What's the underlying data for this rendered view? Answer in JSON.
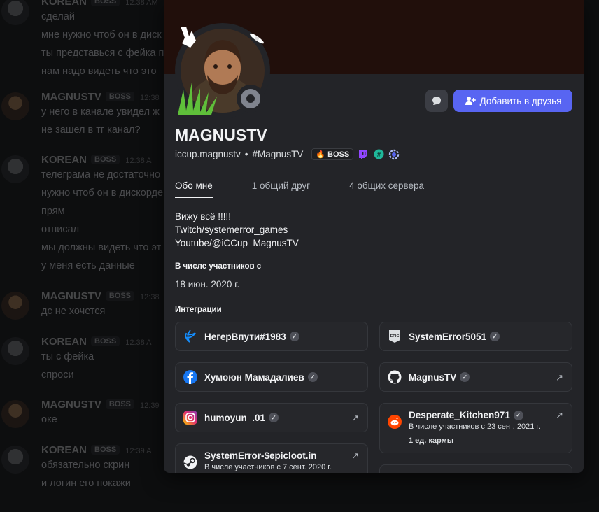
{
  "chat": {
    "messages": [
      {
        "author": "KOREAN",
        "badge": "BOSS",
        "time": "12:38 AM",
        "lines": [
          "сделай",
          "мне нужно чтоб он в диск",
          "ты представься с фейка п",
          "нам надо видеть что это"
        ]
      },
      {
        "author": "MAGNUSTV",
        "badge": "BOSS",
        "time": "12:38",
        "lines": [
          "у него в канале увидел ж",
          "не зашел в тг канал?"
        ]
      },
      {
        "author": "KOREAN",
        "badge": "BOSS",
        "time": "12:38 A",
        "lines": [
          "телеграма не достаточно",
          "нужно чтоб он в дискорде",
          "прям",
          "отписал",
          "мы должны видеть что эт",
          "у меня есть данные"
        ]
      },
      {
        "author": "MAGNUSTV",
        "badge": "BOSS",
        "time": "12:38",
        "lines": [
          "дс не хочется"
        ]
      },
      {
        "author": "KOREAN",
        "badge": "BOSS",
        "time": "12:38 A",
        "lines": [
          "ты с фейка",
          "спроси"
        ]
      },
      {
        "author": "MAGNUSTV",
        "badge": "BOSS",
        "time": "12:39",
        "lines": [
          "оке"
        ]
      },
      {
        "author": "KOREAN",
        "badge": "BOSS",
        "time": "12:39 A",
        "lines": [
          "обязательно скрин",
          "и логин его покажи"
        ]
      }
    ]
  },
  "profile": {
    "display_name": "MAGNUSTV",
    "username": "iccup.magnustv",
    "separator": "•",
    "server_tag": "#MagnusTV",
    "boss_tag": "BOSS",
    "status": "offline",
    "add_friend_label": "Добавить в друзья",
    "tabs": [
      "Обо мне",
      "1 общий друг",
      "4 общих сервера"
    ],
    "bio": [
      "Вижу всё !!!!!",
      "Twitch/systemerror_games",
      "Youtube/@iCCup_MagnusTV"
    ],
    "member_since_title": "В числе участников с",
    "member_since": "18 июн. 2020 г.",
    "integrations_title": "Интеграции",
    "integrations": [
      {
        "service": "battlenet",
        "icon": "battlenet-icon",
        "name": "НегерВпути#1983"
      },
      {
        "service": "epic",
        "icon": "epic-games-icon",
        "name": "SystemError5051"
      },
      {
        "service": "facebook",
        "icon": "facebook-icon",
        "name": "Хумоюн Мамадалиев"
      },
      {
        "service": "github",
        "icon": "github-icon",
        "name": "MagnusTV"
      },
      {
        "service": "instagram",
        "icon": "instagram-icon",
        "name": "humoyun_.01"
      },
      {
        "service": "reddit",
        "icon": "reddit-icon",
        "name": "Desperate_Kitchen971",
        "sub": "В числе участников с 23 сент. 2021 г.",
        "sub2": "1 ед. кармы"
      },
      {
        "service": "steam",
        "icon": "steam-icon",
        "name": "SystemError-$epicloot.in",
        "sub": "В числе участников с 7 сент. 2020 г."
      }
    ],
    "verified_mark": "✓",
    "external_mark": "↗"
  },
  "colors": {
    "accent": "#5865f2",
    "banner": "#210f0b",
    "panel": "#232428",
    "status_offline": "#80848e"
  }
}
